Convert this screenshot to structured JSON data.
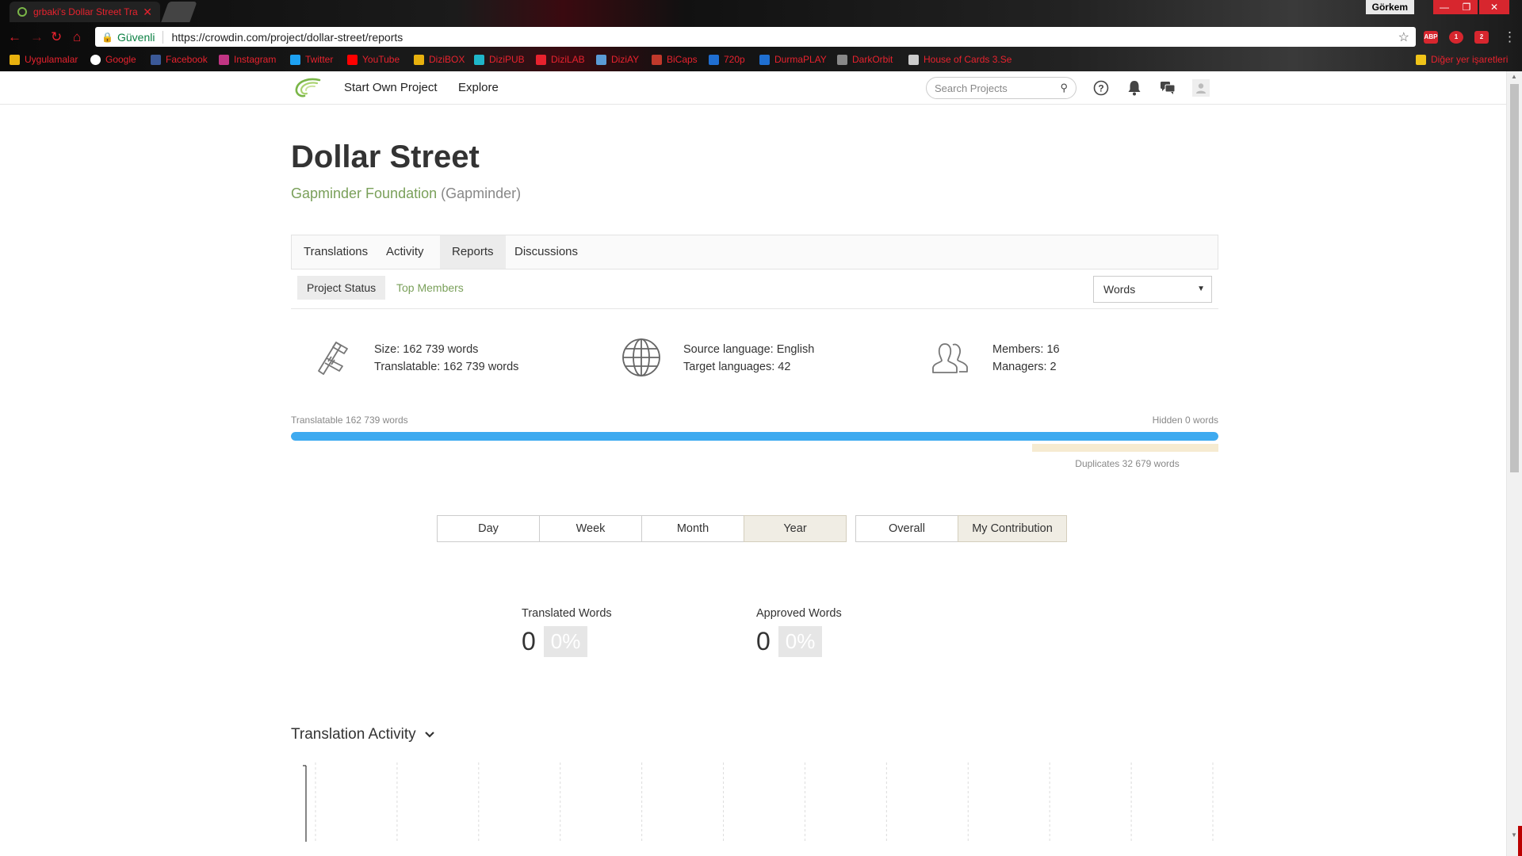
{
  "browser": {
    "tab_title": "grbaki's Dollar Street Tra",
    "window_user": "Görkem",
    "address": {
      "secure_label": "Güvenli",
      "url": "https://crowdin.com/project/dollar-street/reports"
    },
    "extensions": [
      {
        "name": "abp",
        "label": "ABP"
      },
      {
        "name": "opera",
        "label": "1"
      },
      {
        "name": "mail",
        "label": "2"
      }
    ],
    "bookmarks": [
      {
        "label": "Uygulamalar",
        "color": "#e8b10e"
      },
      {
        "label": "Google",
        "color": "#ffffff"
      },
      {
        "label": "Facebook",
        "color": "#3b5998"
      },
      {
        "label": "Instagram",
        "color": "#c13584"
      },
      {
        "label": "Twitter",
        "color": "#1da1f2"
      },
      {
        "label": "YouTube",
        "color": "#ff0000"
      },
      {
        "label": "DiziBOX",
        "color": "#e8b10e"
      },
      {
        "label": "DiziPUB",
        "color": "#1fb6c9"
      },
      {
        "label": "DiziLAB",
        "color": "#e8222e"
      },
      {
        "label": "DiziAY",
        "color": "#5a9bd5"
      },
      {
        "label": "BiCaps",
        "color": "#c0392b"
      },
      {
        "label": "720p",
        "color": "#1f6fd1"
      },
      {
        "label": "DurmaPLAY",
        "color": "#1f6fd1"
      },
      {
        "label": "DarkOrbit",
        "color": "#888888"
      },
      {
        "label": "House of Cards 3.Se",
        "color": "#cccccc"
      }
    ],
    "other_bookmarks": "Diğer yer işaretleri"
  },
  "nav": {
    "start_project": "Start Own Project",
    "explore": "Explore",
    "search_placeholder": "Search Projects"
  },
  "project": {
    "title": "Dollar Street",
    "org_name": "Gapminder Foundation",
    "org_handle": "(Gapminder)"
  },
  "tabs": [
    "Translations",
    "Activity",
    "Reports",
    "Discussions"
  ],
  "active_tab": "Reports",
  "subtabs": {
    "project_status": "Project Status",
    "top_members": "Top Members",
    "unit": "Words"
  },
  "stats": {
    "size": "Size: 162 739 words",
    "translatable": "Translatable: 162 739 words",
    "source_language": "Source language: English",
    "target_languages": "Target languages: 42",
    "members": "Members: 16",
    "managers": "Managers: 2"
  },
  "progress": {
    "left_label": "Translatable 162 739 words",
    "right_label": "Hidden 0 words",
    "translatable_fraction": 1.0,
    "duplicates_label": "Duplicates 32 679 words",
    "duplicates_fraction": 0.2008,
    "bar_color": "#3eaaf0",
    "dup_color": "#f6ebd1"
  },
  "period_buttons": [
    "Day",
    "Week",
    "Month",
    "Year"
  ],
  "active_period": "Year",
  "scope_buttons": [
    "Overall",
    "My Contribution"
  ],
  "active_scope": "My Contribution",
  "metrics": {
    "translated_label": "Translated Words",
    "translated_value": "0",
    "translated_pct": "0%",
    "approved_label": "Approved Words",
    "approved_value": "0",
    "approved_pct": "0%"
  },
  "activity": {
    "title": "Translation Activity"
  },
  "colors": {
    "accent_green": "#7aa05a",
    "chrome_red": "#e8222e"
  }
}
